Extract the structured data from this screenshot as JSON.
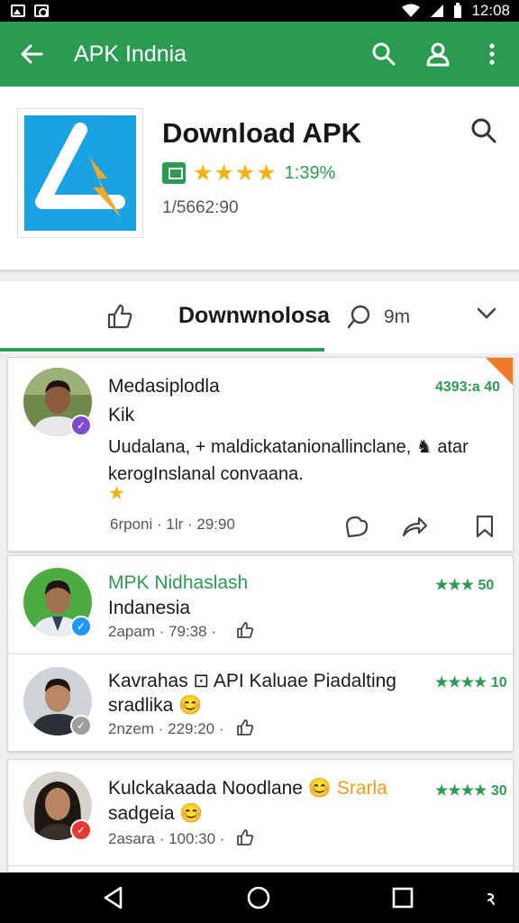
{
  "status_bar": {
    "time": "12:08"
  },
  "app_bar": {
    "title": "APK Indnia",
    "background": "#2c9b52"
  },
  "app_header": {
    "name": "Download APK",
    "stars": "★★★★",
    "rating_count": "1:39%",
    "meta": "1/5662:90",
    "icon_bg": "#1aa3e3"
  },
  "tabs": {
    "active_label": "Downwnolosa",
    "second_label": "9m"
  },
  "featured_review": {
    "name": "Medasiplodla",
    "score": "4393:a 40",
    "subtitle": "Kik",
    "body": "Uudalana, + maldickatanionallinclane, ♞ atar kerogInslanal convaana.",
    "star": "★",
    "meta": "6rponi · 1lr · 29:90"
  },
  "reviews": [
    {
      "name": "MPK Nidhaslash",
      "score": "★★★ 50",
      "subtitle": "Indanesia",
      "meta": "2apam · 79:38 ·"
    },
    {
      "name": "Kavrahas ⊡ API Kaluae Piadalting",
      "score": "★★★★ 10",
      "subtitle": "sradlika 😊",
      "meta": "2nzem · 229:20 ·"
    },
    {
      "name": "Kulckakaada Noodlane 😊",
      "tag": "Srarla",
      "score": "★★★★ 30",
      "subtitle": "sadgeia 😊",
      "meta": "2asara · 100:30 ·"
    }
  ]
}
